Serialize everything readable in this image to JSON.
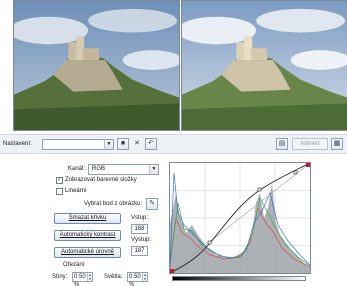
{
  "toolbar": {
    "preset_label": "Nastavení:",
    "preset_value": "",
    "preview_button_label": "Náhled"
  },
  "controls": {
    "channel_label": "Kanál:",
    "channel_value": "RGB",
    "show_color_components_label": "Zobrazovat barevné složky",
    "show_color_components_checked": true,
    "linear_label": "Lineární",
    "linear_checked": false,
    "pick_point_label": "Vybrat bod z obrázku:",
    "delete_curve_label": "Smazat křivku",
    "auto_contrast_label": "Automatický kontrast",
    "auto_levels_label": "Automatické úrovně",
    "input_label": "Vstup:",
    "input_value": "168",
    "output_label": "Výstup:",
    "output_value": "187",
    "clipping_label": "Ořezání",
    "shadows_label": "Stíny:",
    "shadows_value": "0.50 %",
    "highlights_label": "Světla:",
    "highlights_value": "0.50 %"
  },
  "colors": {
    "accent": "#2a3f66",
    "curve_point": "#c0192a",
    "check": "#1f6a1f"
  },
  "icons": [
    "save-icon",
    "delete-icon",
    "reset-icon",
    "layout-icon",
    "settings-icon",
    "eyedropper-icon"
  ]
}
